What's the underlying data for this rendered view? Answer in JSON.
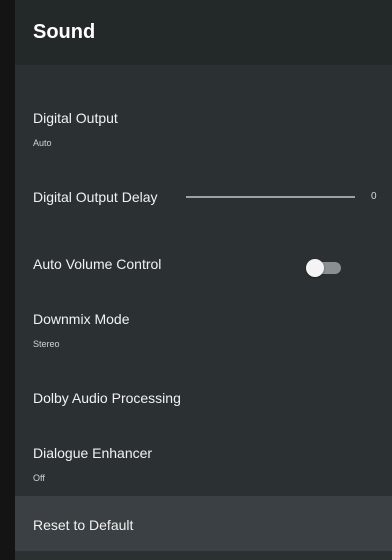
{
  "header": {
    "title": "Sound"
  },
  "settings": {
    "digital_output": {
      "label": "Digital Output",
      "value": "Auto"
    },
    "digital_output_delay": {
      "label": "Digital Output Delay",
      "value": "0"
    },
    "auto_volume_control": {
      "label": "Auto Volume Control",
      "enabled": false
    },
    "downmix_mode": {
      "label": "Downmix Mode",
      "value": "Stereo"
    },
    "dolby_audio_processing": {
      "label": "Dolby Audio Processing"
    },
    "dialogue_enhancer": {
      "label": "Dialogue Enhancer",
      "value": "Off"
    },
    "reset": {
      "label": "Reset to Default"
    }
  },
  "colors": {
    "background": "#2b3133",
    "header_background": "#232829",
    "selected_item_background": "#3a4043",
    "text": "#f1f1f1",
    "subtext": "#d3d3d3"
  }
}
